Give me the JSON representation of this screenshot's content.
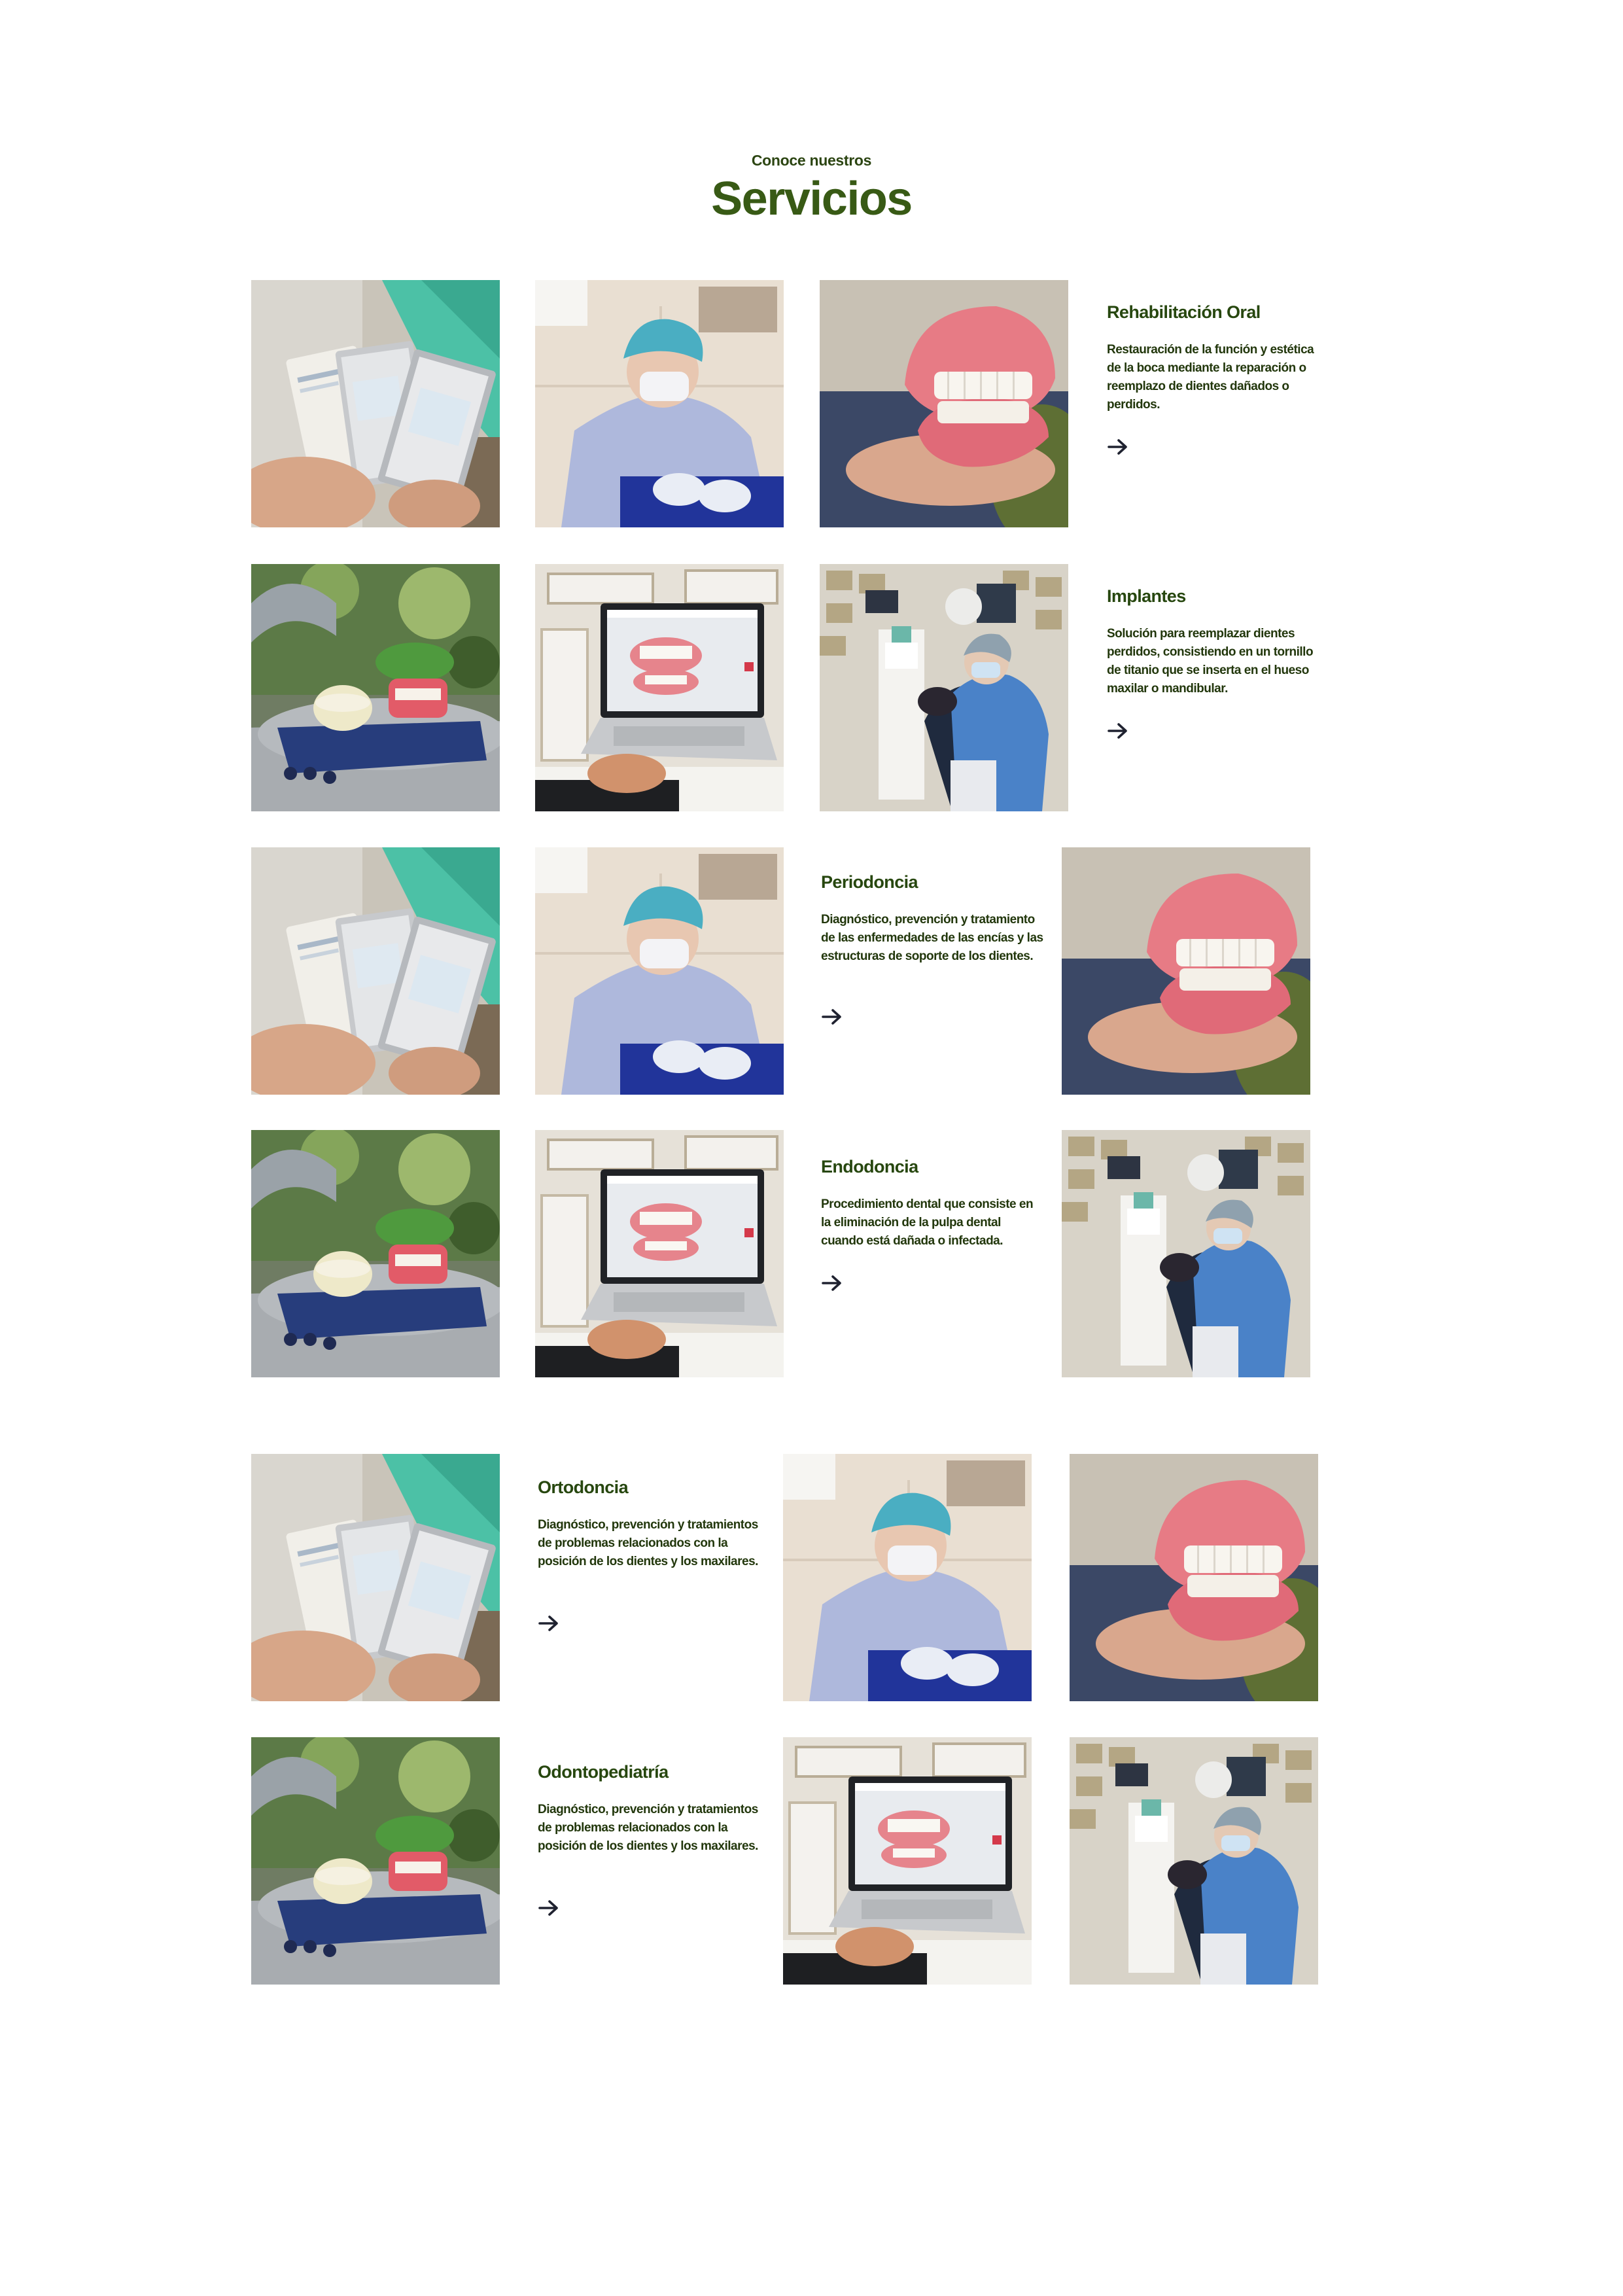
{
  "header": {
    "eyebrow": "Conoce nuestros",
    "title": "Servicios"
  },
  "services": [
    {
      "title": "Rehabilitación Oral",
      "description": "Restauración de la función y estética de la boca mediante la reparación o reemplazo de dientes dañados o perdidos.",
      "link_icon": "arrow-right-icon"
    },
    {
      "title": "Implantes",
      "description": "Solución para reemplazar dientes perdidos, consistiendo en un tornillo de titanio que se inserta en el hueso maxilar o mandibular.",
      "link_icon": "arrow-right-icon"
    },
    {
      "title": "Periodoncia",
      "description": "Diagnóstico, prevención y tratamiento de las enfermedades de las encías y las estructuras de soporte de los dientes.",
      "link_icon": "arrow-right-icon"
    },
    {
      "title": "Endodoncia",
      "description": "Procedimiento dental que consiste en la eliminación de la pulpa dental cuando está dañada o infectada.",
      "link_icon": "arrow-right-icon"
    },
    {
      "title": "Ortodoncia",
      "description": "Diagnóstico, prevención y tratamientos de problemas relacionados con la posición de los dientes y los maxilares.",
      "link_icon": "arrow-right-icon"
    },
    {
      "title": "Odontopediatría",
      "description": "Diagnóstico, prevención y tratamientos de problemas relacionados con la posición de los dientes y los maxilares.",
      "link_icon": "arrow-right-icon"
    }
  ],
  "photos": {
    "aligner-packs": "aligner-packs-photo",
    "dentist-at-work": "dentist-at-work-photo",
    "teeth-model": "teeth-model-photo",
    "dental-models-on-chair": "dental-models-on-chair-photo",
    "laptop-3d-scan": "laptop-3d-scan-photo",
    "dentist-with-patient": "dentist-with-patient-photo"
  },
  "colors": {
    "title_green": "#385a15",
    "text_green": "#24400f",
    "arrow": "#1f2230"
  }
}
